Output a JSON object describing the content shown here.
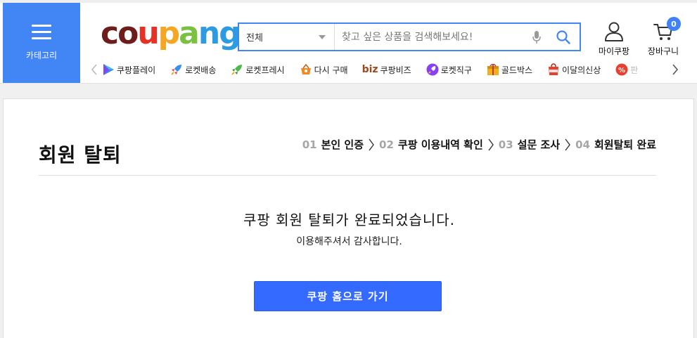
{
  "header": {
    "category_label": "카테고리",
    "logo": {
      "text": "coupang",
      "letters": [
        {
          "ch": "c",
          "color": "#6d1d1a"
        },
        {
          "ch": "o",
          "color": "#6d1d1a"
        },
        {
          "ch": "u",
          "color": "#e63226"
        },
        {
          "ch": "p",
          "color": "#f5a623"
        },
        {
          "ch": "a",
          "color": "#7ac142"
        },
        {
          "ch": "n",
          "color": "#2d9be2"
        },
        {
          "ch": "g",
          "color": "#2d9be2"
        }
      ]
    },
    "search": {
      "scope": "전체",
      "placeholder": "찾고 싶은 상품을 검색해보세요!"
    },
    "mycoupang_label": "마이쿠팡",
    "cart_label": "장바구니",
    "cart_count": "0"
  },
  "nav": {
    "items": [
      {
        "label": "쿠팡플레이",
        "icon": "play-icon"
      },
      {
        "label": "로켓배송",
        "icon": "rocket-icon"
      },
      {
        "label": "로켓프레시",
        "icon": "rocket-fresh-icon"
      },
      {
        "label": "다시 구매",
        "icon": "basket-icon"
      },
      {
        "label": "쿠팡비즈",
        "icon": "biz-icon",
        "prefix": "biz"
      },
      {
        "label": "로켓직구",
        "icon": "rocket-global-icon"
      },
      {
        "label": "골드박스",
        "icon": "gold-box-icon"
      },
      {
        "label": "이달의신상",
        "icon": "new-icon"
      },
      {
        "label": "판",
        "icon": "sale-icon"
      }
    ]
  },
  "page": {
    "title": "회원 탈퇴",
    "steps": [
      {
        "num": "01",
        "label": "본인 인증"
      },
      {
        "num": "02",
        "label": "쿠팡 이용내역 확인"
      },
      {
        "num": "03",
        "label": "설문 조사"
      },
      {
        "num": "04",
        "label": "회원탈퇴 완료"
      }
    ],
    "message": "쿠팡 회원 탈퇴가 완료되었습니다.",
    "submessage": "이용해주셔서 감사합니다.",
    "home_button": "쿠팡 홈으로 가기"
  },
  "colors": {
    "accent": "#4285f4",
    "button": "#346aff",
    "badge": "#3f81f7"
  }
}
